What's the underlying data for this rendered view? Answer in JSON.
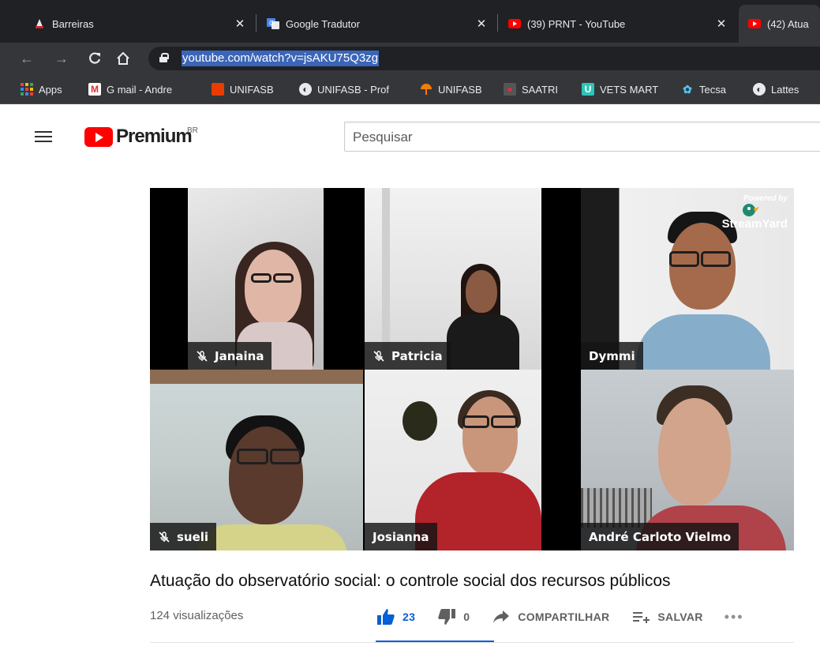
{
  "browser": {
    "tabs": [
      {
        "title": "Barreiras",
        "icon": "barreiras-favicon"
      },
      {
        "title": "Google Tradutor",
        "icon": "google-translate-favicon"
      },
      {
        "title": "(39) PRNT - YouTube",
        "icon": "youtube-favicon"
      },
      {
        "title": "(42) Atua",
        "icon": "youtube-favicon"
      }
    ],
    "url": "youtube.com/watch?v=jsAKU75Q3zg",
    "bookmarks": [
      {
        "label": "Apps",
        "icon": "apps-grid-icon"
      },
      {
        "label": "G mail - Andre",
        "icon": "gmail-icon",
        "color": "#d93025"
      },
      {
        "label": "UNIFASB",
        "icon": "office-icon",
        "color": "#eb3c00"
      },
      {
        "label": "UNIFASB - Prof",
        "icon": "globe-icon"
      },
      {
        "label": "UNIFASB",
        "icon": "umbrella-icon",
        "color": "#f57c00"
      },
      {
        "label": "SAATRI",
        "icon": "saatri-icon",
        "color": "#d13438"
      },
      {
        "label": "VETS MART",
        "icon": "vetsmart-icon",
        "color": "#2ec4b6"
      },
      {
        "label": "Tecsa",
        "icon": "paw-icon",
        "color": "#4fc3f7"
      },
      {
        "label": "Lattes",
        "icon": "globe-icon"
      }
    ]
  },
  "youtube": {
    "logo_text": "Premium",
    "region": "BR",
    "search_placeholder": "Pesquisar",
    "video": {
      "title": "Atuação do observatório social: o controle social dos recursos públicos",
      "views": "124 visualizações",
      "likes": "23",
      "dislikes": "0",
      "share_label": "COMPARTILHAR",
      "save_label": "SALVAR",
      "more_label": "•••",
      "streamyard_by": "Powered by",
      "streamyard_name": "StreamYard",
      "participants": [
        {
          "name": "Janaina",
          "muted": true
        },
        {
          "name": "Patricia",
          "muted": true
        },
        {
          "name": "Dymmi",
          "muted": false
        },
        {
          "name": "sueli",
          "muted": true
        },
        {
          "name": "Josianna",
          "muted": false
        },
        {
          "name": "André Carloto Vielmo",
          "muted": false
        }
      ]
    }
  },
  "colors": {
    "tab_bg": "#202124",
    "toolbar_bg": "#35363a",
    "youtube_red": "#ff0000",
    "like_blue": "#065fd4"
  }
}
